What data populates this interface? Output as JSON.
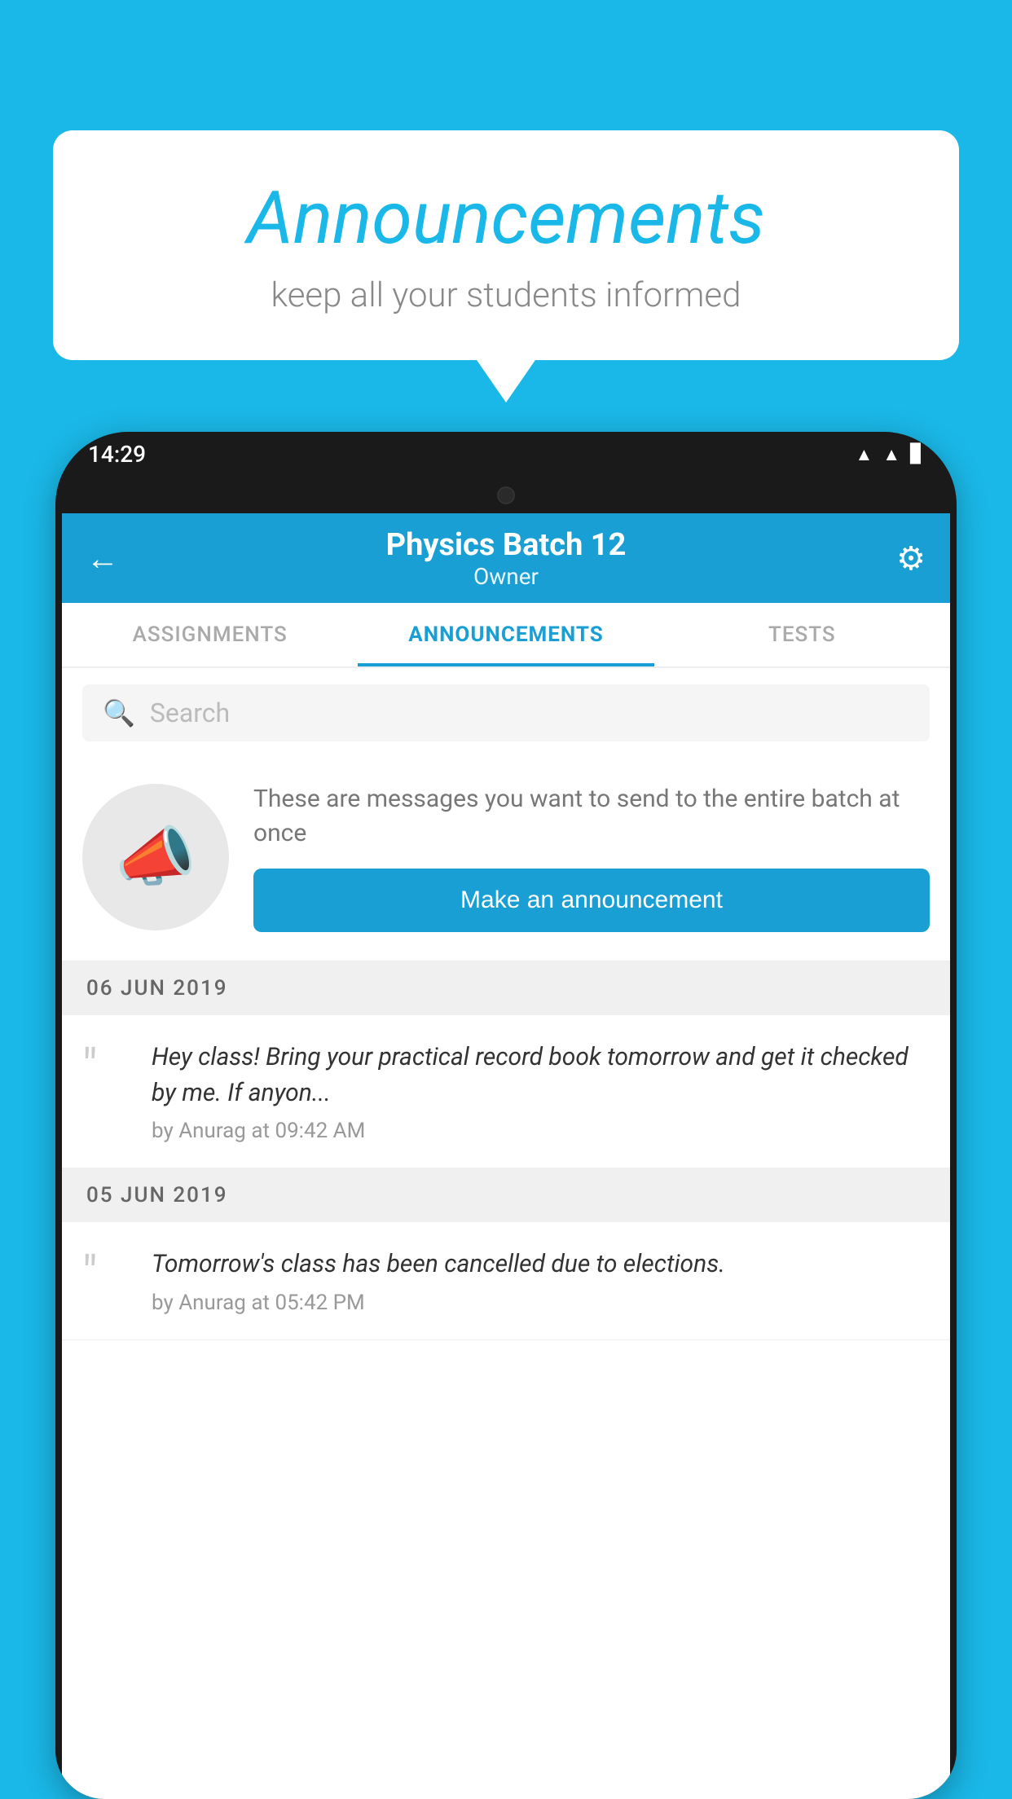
{
  "page": {
    "background_color": "#1ab8e8"
  },
  "speech_bubble": {
    "title": "Announcements",
    "subtitle": "keep all your students informed"
  },
  "phone": {
    "status_bar": {
      "time": "14:29",
      "icons": [
        "wifi",
        "signal",
        "battery"
      ]
    },
    "toolbar": {
      "back_icon": "←",
      "title": "Physics Batch 12",
      "subtitle": "Owner",
      "settings_icon": "⚙"
    },
    "tabs": [
      {
        "label": "ASSIGNMENTS",
        "active": false
      },
      {
        "label": "ANNOUNCEMENTS",
        "active": true
      },
      {
        "label": "TESTS",
        "active": false
      }
    ],
    "search": {
      "placeholder": "Search",
      "icon": "🔍"
    },
    "announcement_cta": {
      "description_text": "These are messages you want to send to the entire batch at once",
      "button_label": "Make an announcement"
    },
    "announcements": [
      {
        "date": "06  JUN  2019",
        "items": [
          {
            "message": "Hey class! Bring your practical record book tomorrow and get it checked by me. If anyon...",
            "author": "by Anurag at 09:42 AM"
          }
        ]
      },
      {
        "date": "05  JUN  2019",
        "items": [
          {
            "message": "Tomorrow's class has been cancelled due to elections.",
            "author": "by Anurag at 05:42 PM"
          }
        ]
      }
    ]
  }
}
